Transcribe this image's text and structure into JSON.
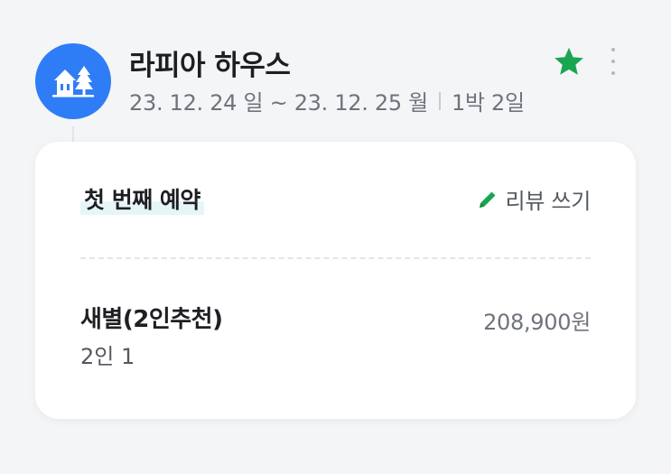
{
  "stay": {
    "place_name": "라피아 하우스",
    "dates": "23. 12. 24 일 ~ 23. 12. 25 월",
    "nights": "1박 2일",
    "avatar_icon": "cabin-with-trees-icon",
    "favorite_icon": "star-icon",
    "more_icon": "more-vertical-icon"
  },
  "reservation": {
    "label": "첫 번째 예약",
    "review_label": "리뷰 쓰기",
    "review_icon": "pencil-icon",
    "room_name": "새별(2인추천)",
    "guests": "2인 1",
    "price": "208,900원"
  },
  "colors": {
    "accent_blue": "#2f7df6",
    "favorite_green": "#1aa551",
    "highlight": "#e6f6f8"
  }
}
